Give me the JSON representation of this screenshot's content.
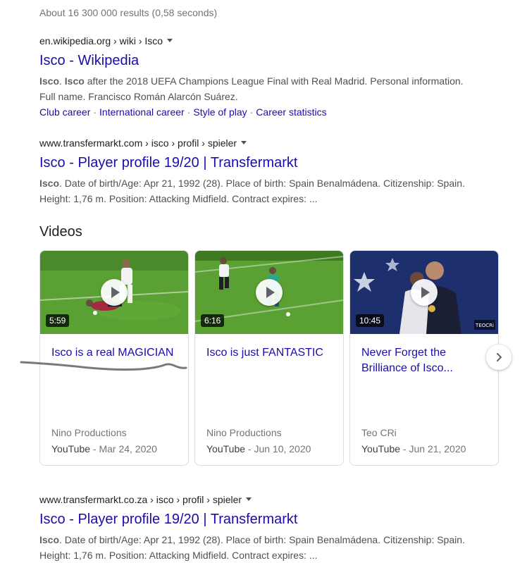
{
  "stats": "About 16 300 000 results (0,58 seconds)",
  "results": [
    {
      "cite": "en.wikipedia.org › wiki › Isco",
      "title": "Isco - Wikipedia",
      "snippet_b1": "Isco",
      "snippet_b2": "Isco",
      "snippet_rest": " after the 2018 UEFA Champions League Final with Real Madrid. Personal information. Full name. Francisco Román Alarcón Suárez.",
      "sitelinks": [
        "Club career",
        "International career",
        "Style of play",
        "Career statistics"
      ]
    },
    {
      "cite": "www.transfermarkt.com › isco › profil › spieler",
      "title": "Isco - Player profile 19/20 | Transfermarkt",
      "snippet_b": "Isco",
      "snippet_rest": ". Date of birth/Age: Apr 21, 1992 (28). Place of birth: Spain Benalmádena. Citizenship: Spain. Height: 1,76 m. Position: Attacking Midfield. Contract expires: ..."
    },
    {
      "cite": "www.transfermarkt.co.za › isco › profil › spieler",
      "title": "Isco - Player profile 19/20 | Transfermarkt",
      "snippet_b": "Isco",
      "snippet_rest": ". Date of birth/Age: Apr 21, 1992 (28). Place of birth: Spain Benalmádena. Citizenship: Spain. Height: 1,76 m. Position: Attacking Midfield. Contract expires: ..."
    }
  ],
  "videos": {
    "heading": "Videos",
    "items": [
      {
        "duration": "5:59",
        "title": "Isco is a real MAGICIAN",
        "source": "Nino Productions",
        "platform": "YouTube",
        "date": " - Mar 24, 2020"
      },
      {
        "duration": "6:16",
        "title": "Isco is just FANTASTIC",
        "source": "Nino Productions",
        "platform": "YouTube",
        "date": " - Jun 10, 2020"
      },
      {
        "duration": "10:45",
        "title": "Never Forget the Brilliance of Isco...",
        "source": "Teo CRi",
        "platform": "YouTube",
        "date": " - Jun 21, 2020"
      }
    ],
    "watermark": "TEOCRi"
  },
  "colors": {
    "link": "#1a0dab",
    "snippet": "#4d5156",
    "meta": "#70757a",
    "pitch": "#5aa032"
  },
  "icons": {
    "next": "chevron-right-icon",
    "play": "play-icon",
    "menu": "caret-down-icon"
  }
}
